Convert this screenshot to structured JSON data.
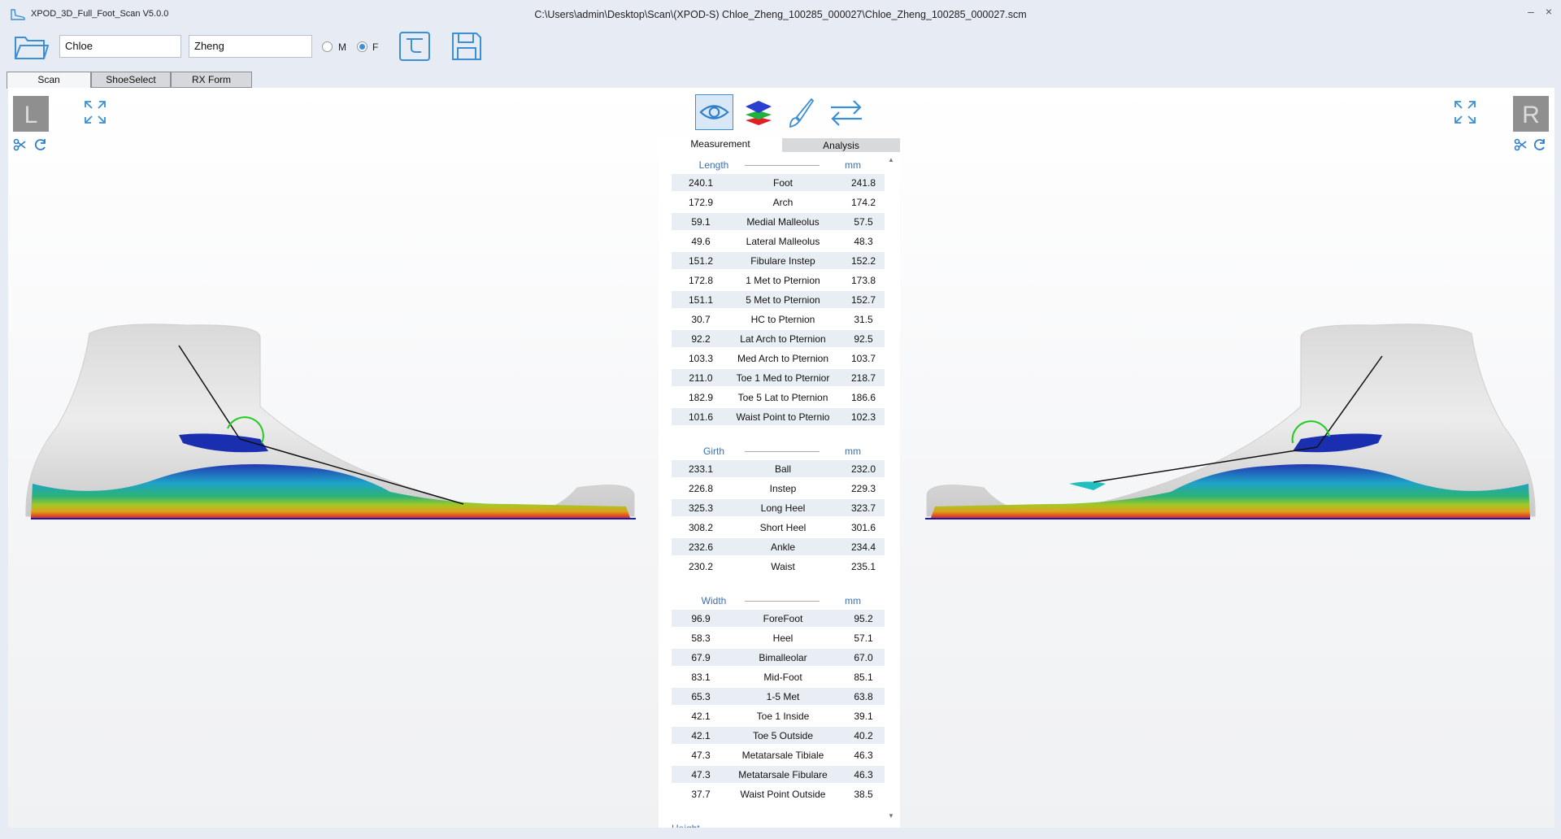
{
  "window": {
    "app_title": "XPOD_3D_Full_Foot_Scan V5.0.0",
    "file_path": "C:\\Users\\admin\\Desktop\\Scan\\(XPOD-S) Chloe_Zheng_100285_000027\\Chloe_Zheng_100285_000027.scm",
    "minimize_glyph": "–",
    "close_glyph": "×"
  },
  "toolbar": {
    "first_name": "Chloe",
    "last_name": "Zheng",
    "gender_options": [
      "M",
      "F"
    ],
    "gender_selected": "F"
  },
  "tabs": [
    "Scan",
    "ShoeSelect",
    "RX Form"
  ],
  "viewer": {
    "left_label": "L",
    "right_label": "R",
    "accent_color": "#3b8fd6"
  },
  "panel": {
    "tabs": [
      "Measurement",
      "Analysis"
    ],
    "sections": [
      {
        "name": "Length",
        "unit": "mm",
        "rows": [
          {
            "left": "240.1",
            "name": "Foot",
            "right": "241.8"
          },
          {
            "left": "172.9",
            "name": "Arch",
            "right": "174.2"
          },
          {
            "left": "59.1",
            "name": "Medial Malleolus",
            "right": "57.5"
          },
          {
            "left": "49.6",
            "name": "Lateral Malleolus",
            "right": "48.3"
          },
          {
            "left": "151.2",
            "name": "Fibulare Instep",
            "right": "152.2"
          },
          {
            "left": "172.8",
            "name": "1 Met to Pternion",
            "right": "173.8"
          },
          {
            "left": "151.1",
            "name": "5 Met to Pternion",
            "right": "152.7"
          },
          {
            "left": "30.7",
            "name": "HC to Pternion",
            "right": "31.5"
          },
          {
            "left": "92.2",
            "name": "Lat Arch to Pternion",
            "right": "92.5"
          },
          {
            "left": "103.3",
            "name": "Med Arch to Pternion",
            "right": "103.7"
          },
          {
            "left": "211.0",
            "name": "Toe 1 Med to Pternior",
            "right": "218.7"
          },
          {
            "left": "182.9",
            "name": "Toe 5 Lat to Pternion",
            "right": "186.6"
          },
          {
            "left": "101.6",
            "name": "Waist Point to Pternio",
            "right": "102.3"
          }
        ]
      },
      {
        "name": "Girth",
        "unit": "mm",
        "rows": [
          {
            "left": "233.1",
            "name": "Ball",
            "right": "232.0"
          },
          {
            "left": "226.8",
            "name": "Instep",
            "right": "229.3"
          },
          {
            "left": "325.3",
            "name": "Long Heel",
            "right": "323.7"
          },
          {
            "left": "308.2",
            "name": "Short Heel",
            "right": "301.6"
          },
          {
            "left": "232.6",
            "name": "Ankle",
            "right": "234.4"
          },
          {
            "left": "230.2",
            "name": "Waist",
            "right": "235.1"
          }
        ]
      },
      {
        "name": "Width",
        "unit": "mm",
        "rows": [
          {
            "left": "96.9",
            "name": "ForeFoot",
            "right": "95.2"
          },
          {
            "left": "58.3",
            "name": "Heel",
            "right": "57.1"
          },
          {
            "left": "67.9",
            "name": "Bimalleolar",
            "right": "67.0"
          },
          {
            "left": "83.1",
            "name": "Mid-Foot",
            "right": "85.1"
          },
          {
            "left": "65.3",
            "name": "1-5 Met",
            "right": "63.8"
          },
          {
            "left": "42.1",
            "name": "Toe 1 Inside",
            "right": "39.1"
          },
          {
            "left": "42.1",
            "name": "Toe 5 Outside",
            "right": "40.2"
          },
          {
            "left": "47.3",
            "name": "Metatarsale Tibiale",
            "right": "46.3"
          },
          {
            "left": "47.3",
            "name": "Metatarsale Fibulare",
            "right": "46.3"
          },
          {
            "left": "37.7",
            "name": "Waist Point Outside",
            "right": "38.5"
          }
        ]
      }
    ],
    "next_section_partial": "Height"
  }
}
